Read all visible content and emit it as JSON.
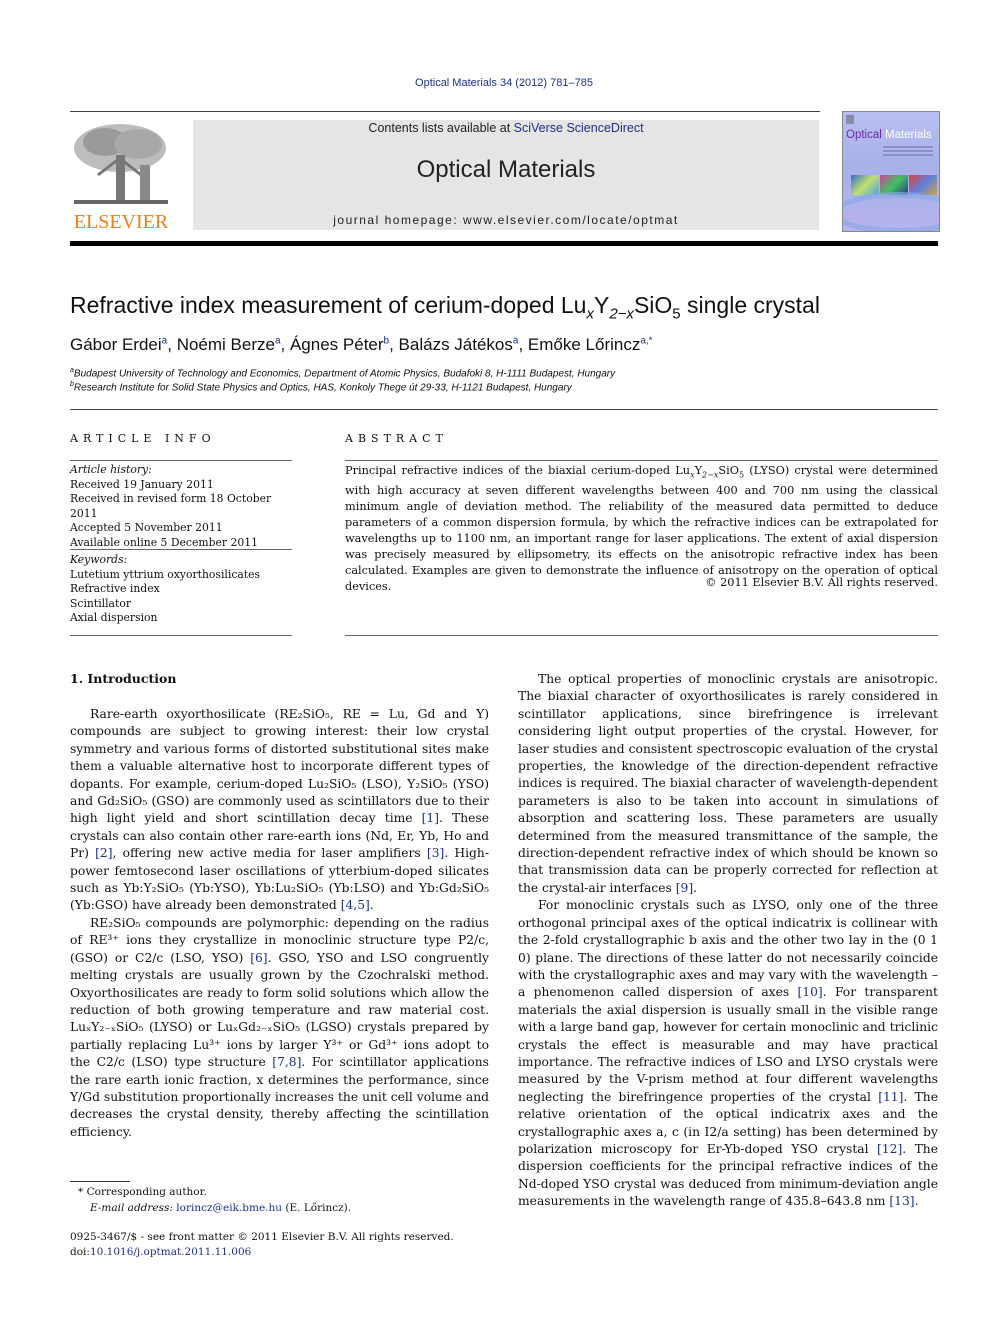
{
  "header": {
    "journal_ref": "Optical Materials 34 (2012) 781–785",
    "contents_prefix": "Contents lists available at ",
    "contents_link": "SciVerse ScienceDirect",
    "journal_title": "Optical Materials",
    "homepage_label": "journal homepage: www.elsevier.com/locate/optmat",
    "publisher_logo": "ELSEVIER",
    "cover_title_a": "Optical",
    "cover_title_b": " Materials"
  },
  "article": {
    "title_pre": "Refractive index measurement of cerium-doped Lu",
    "title_sub1": "x",
    "title_y": "Y",
    "title_sub2": "2−x",
    "title_sio": "SiO",
    "title_sub3": "5",
    "title_post": " single crystal",
    "authors": [
      {
        "name": "Gábor Erdei",
        "aff": "a"
      },
      {
        "name": "Noémi Berze",
        "aff": "a"
      },
      {
        "name": "Ágnes Péter",
        "aff": "b"
      },
      {
        "name": "Balázs Játékos",
        "aff": "a"
      },
      {
        "name": "Emőke Lőrincz",
        "aff": "a,*"
      }
    ],
    "affiliations": [
      {
        "mark": "a",
        "text": "Budapest University of Technology and Economics, Department of Atomic Physics, Budafoki 8, H-1111 Budapest, Hungary"
      },
      {
        "mark": "b",
        "text": "Research Institute for Solid State Physics and Optics, HAS, Konkoly Thege út 29-33, H-1121 Budapest, Hungary"
      }
    ]
  },
  "article_info": {
    "heading": "ARTICLE INFO",
    "history_label": "Article history:",
    "history": [
      "Received 19 January 2011",
      "Received in revised form 18 October 2011",
      "Accepted 5 November 2011",
      "Available online 5 December 2011"
    ],
    "keywords_label": "Keywords:",
    "keywords": [
      "Lutetium yttrium oxyorthosilicates",
      "Refractive index",
      "Scintillator",
      "Axial dispersion"
    ]
  },
  "abstract": {
    "heading": "ABSTRACT",
    "p1": "Principal refractive indices of the biaxial cerium-doped Lu",
    "p1_sub1": "x",
    "p1_y": "Y",
    "p1_sub2": "2−x",
    "p1_sio": "SiO",
    "p1_sub3": "5",
    "p2": " (LYSO) crystal were determined with high accuracy at seven different wavelengths between 400 and 700 nm using the classical minimum angle of deviation method. The reliability of the measured data permitted to deduce parameters of a common dispersion formula, by which the refractive indices can be extrapolated for wavelengths up to 1100 nm, an important range for laser applications. The extent of axial dispersion was precisely measured by ellipsometry, its effects on the anisotropic refractive index has been calculated. Examples are given to demonstrate the influence of anisotropy on the operation of optical devices.",
    "copyright": "© 2011 Elsevier B.V. All rights reserved."
  },
  "intro": {
    "heading": "1. Introduction",
    "left_p1": "Rare-earth oxyorthosilicate (RE₂SiO₅, RE = Lu, Gd and Y) compounds are subject to growing interest: their low crystal symmetry and various forms of distorted substitutional sites make them a valuable alternative host to incorporate different types of dopants. For example, cerium-doped Lu₂SiO₅ (LSO), Y₂SiO₅ (YSO) and Gd₂SiO₅ (GSO) are commonly used as scintillators due to their high light yield and short scintillation decay time ",
    "cite1": "[1]",
    "left_p1b": ". These crystals can also contain other rare-earth ions (Nd, Er, Yb, Ho and Pr) ",
    "cite2": "[2]",
    "left_p1c": ", offering new active media for laser amplifiers ",
    "cite3": "[3]",
    "left_p1d": ". High-power femtosecond laser oscillations of ytterbium-doped silicates such as Yb:Y₂SiO₅ (Yb:YSO), Yb:Lu₂SiO₅ (Yb:LSO) and Yb:Gd₂SiO₅ (Yb:GSO) have already been demonstrated ",
    "cite45": "[4,5]",
    "left_p2a": "RE₂SiO₅ compounds are polymorphic: depending on the radius of RE³⁺ ions they crystallize in monoclinic structure type P2/c, (GSO) or C2/c (LSO, YSO) ",
    "cite6": "[6]",
    "left_p2b": ". GSO, YSO and LSO congruently melting crystals are usually grown by the Czochralski method. Oxyorthosilicates are ready to form solid solutions which allow the reduction of both growing temperature and raw material cost. LuₓY₂₋ₓSiO₅ (LYSO) or LuₓGd₂₋ₓSiO₅ (LGSO) crystals prepared by partially replacing Lu³⁺ ions by larger Y³⁺ or Gd³⁺ ions adopt to the C2/c (LSO) type structure ",
    "cite78": "[7,8]",
    "left_p2c": ". For scintillator applications the rare earth ionic fraction, x determines the performance, since Y/Gd substitution proportionally increases the unit cell volume and decreases the crystal density, thereby affecting the scintillation efficiency.",
    "right_p1a": "The optical properties of monoclinic crystals are anisotropic. The biaxial character of oxyorthosilicates is rarely considered in scintillator applications, since birefringence is irrelevant considering light output properties of the crystal. However, for laser studies and consistent spectroscopic evaluation of the crystal properties, the knowledge of the direction-dependent refractive indices is required. The biaxial character of wavelength-dependent parameters is also to be taken into account in simulations of absorption and scattering loss. These parameters are usually determined from the measured transmittance of the sample, the direction-dependent refractive index of which should be known so that transmission data can be properly corrected for reflection at the crystal-air interfaces ",
    "cite9": "[9]",
    "right_p2a": "For monoclinic crystals such as LYSO, only one of the three orthogonal principal axes of the optical indicatrix is collinear with the 2-fold crystallographic b axis and the other two lay in the (0 1 0) plane. The directions of these latter do not necessarily coincide with the crystallographic axes and may vary with the wavelength – a phenomenon called dispersion of axes ",
    "cite10": "[10]",
    "right_p2b": ". For transparent materials the axial dispersion is usually small in the visible range with a large band gap, however for certain monoclinic and triclinic crystals the effect is measurable and may have practical importance. The refractive indices of LSO and LYSO crystals were measured by the V-prism method at four different wavelengths neglecting the birefringence properties of the crystal ",
    "cite11": "[11]",
    "right_p2c": ". The relative orientation of the optical indicatrix axes and the crystallographic axes a, c (in I2/a setting) has been determined by polarization microscopy for Er-Yb-doped YSO crystal ",
    "cite12": "[12]",
    "right_p2d": ". The dispersion coefficients for the principal refractive indices of the Nd-doped YSO crystal was deduced from minimum-deviation angle measurements in the wavelength range of 435.8–643.8 nm ",
    "cite13": "[13]"
  },
  "footer": {
    "corresponding": "Corresponding author.",
    "email_label": "E-mail address: ",
    "email": "lorincz@eik.bme.hu",
    "email_suffix": " (E. Lőrincz).",
    "issn": "0925-3467/$ - see front matter © 2011 Elsevier B.V. All rights reserved.",
    "doi_label": "doi:",
    "doi": "10.1016/j.optmat.2011.11.006"
  }
}
